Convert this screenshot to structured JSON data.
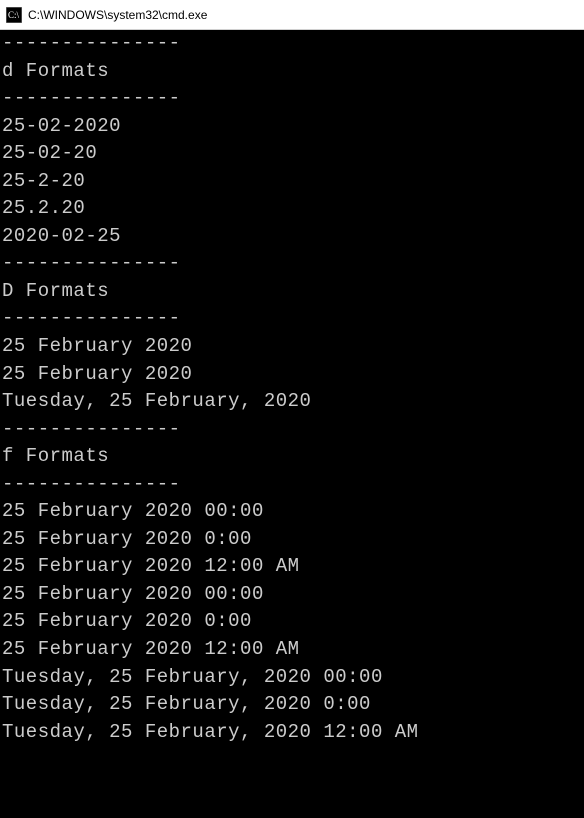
{
  "window": {
    "title": "C:\\WINDOWS\\system32\\cmd.exe"
  },
  "console": {
    "lines": [
      "---------------",
      "d Formats",
      "---------------",
      "25-02-2020",
      "25-02-20",
      "25-2-20",
      "25.2.20",
      "2020-02-25",
      "---------------",
      "D Formats",
      "---------------",
      "25 February 2020",
      "25 February 2020",
      "Tuesday, 25 February, 2020",
      "---------------",
      "f Formats",
      "---------------",
      "25 February 2020 00:00",
      "25 February 2020 0:00",
      "25 February 2020 12:00 AM",
      "25 February 2020 00:00",
      "25 February 2020 0:00",
      "25 February 2020 12:00 AM",
      "Tuesday, 25 February, 2020 00:00",
      "Tuesday, 25 February, 2020 0:00",
      "Tuesday, 25 February, 2020 12:00 AM"
    ]
  }
}
